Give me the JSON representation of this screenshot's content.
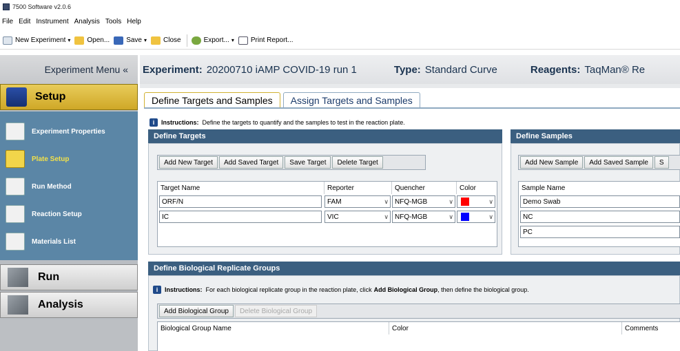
{
  "window": {
    "title": "7500 Software v2.0.6"
  },
  "menu": [
    "File",
    "Edit",
    "Instrument",
    "Analysis",
    "Tools",
    "Help"
  ],
  "toolbar": {
    "new_experiment": "New Experiment",
    "open": "Open...",
    "save": "Save",
    "close": "Close",
    "export": "Export...",
    "print_report": "Print Report..."
  },
  "sidebar": {
    "experiment_menu": "Experiment Menu «",
    "setup": "Setup",
    "items": [
      {
        "label": "Experiment Properties"
      },
      {
        "label": "Plate Setup"
      },
      {
        "label": "Run Method"
      },
      {
        "label": "Reaction Setup"
      },
      {
        "label": "Materials List"
      }
    ],
    "run": "Run",
    "analysis": "Analysis"
  },
  "header": {
    "experiment_key": "Experiment:",
    "experiment_val": "20200710 iAMP COVID-19 run 1",
    "type_key": "Type:",
    "type_val": "Standard Curve",
    "reagents_key": "Reagents:",
    "reagents_val": "TaqMan® Re"
  },
  "tabs": [
    {
      "label": "Define Targets and Samples"
    },
    {
      "label": "Assign Targets and Samples"
    }
  ],
  "instructions": {
    "label": "Instructions:",
    "text": "Define the targets to quantify and the samples to test in the reaction plate."
  },
  "define_targets": {
    "title": "Define Targets",
    "buttons": [
      "Add New Target",
      "Add Saved Target",
      "Save Target",
      "Delete Target"
    ],
    "columns": [
      "Target Name",
      "Reporter",
      "Quencher",
      "Color"
    ],
    "rows": [
      {
        "name": "ORF/N",
        "reporter": "FAM",
        "quencher": "NFQ-MGB",
        "color": "#ff0000"
      },
      {
        "name": "IC",
        "reporter": "VIC",
        "quencher": "NFQ-MGB",
        "color": "#0000ff"
      }
    ]
  },
  "define_samples": {
    "title": "Define Samples",
    "buttons": [
      "Add New Sample",
      "Add Saved Sample",
      "S"
    ],
    "columns": [
      "Sample Name"
    ],
    "rows": [
      "Demo Swab",
      "NC",
      "PC"
    ]
  },
  "bio_groups": {
    "title": "Define Biological Replicate Groups",
    "instructions_label": "Instructions:",
    "instructions_pre": "For each biological replicate group in the reaction plate, click",
    "instructions_bold": "Add Biological Group",
    "instructions_post": ", then define the biological group.",
    "buttons": [
      "Add Biological Group",
      "Delete Biological Group"
    ],
    "columns": [
      "Biological Group Name",
      "Color",
      "Comments"
    ]
  }
}
